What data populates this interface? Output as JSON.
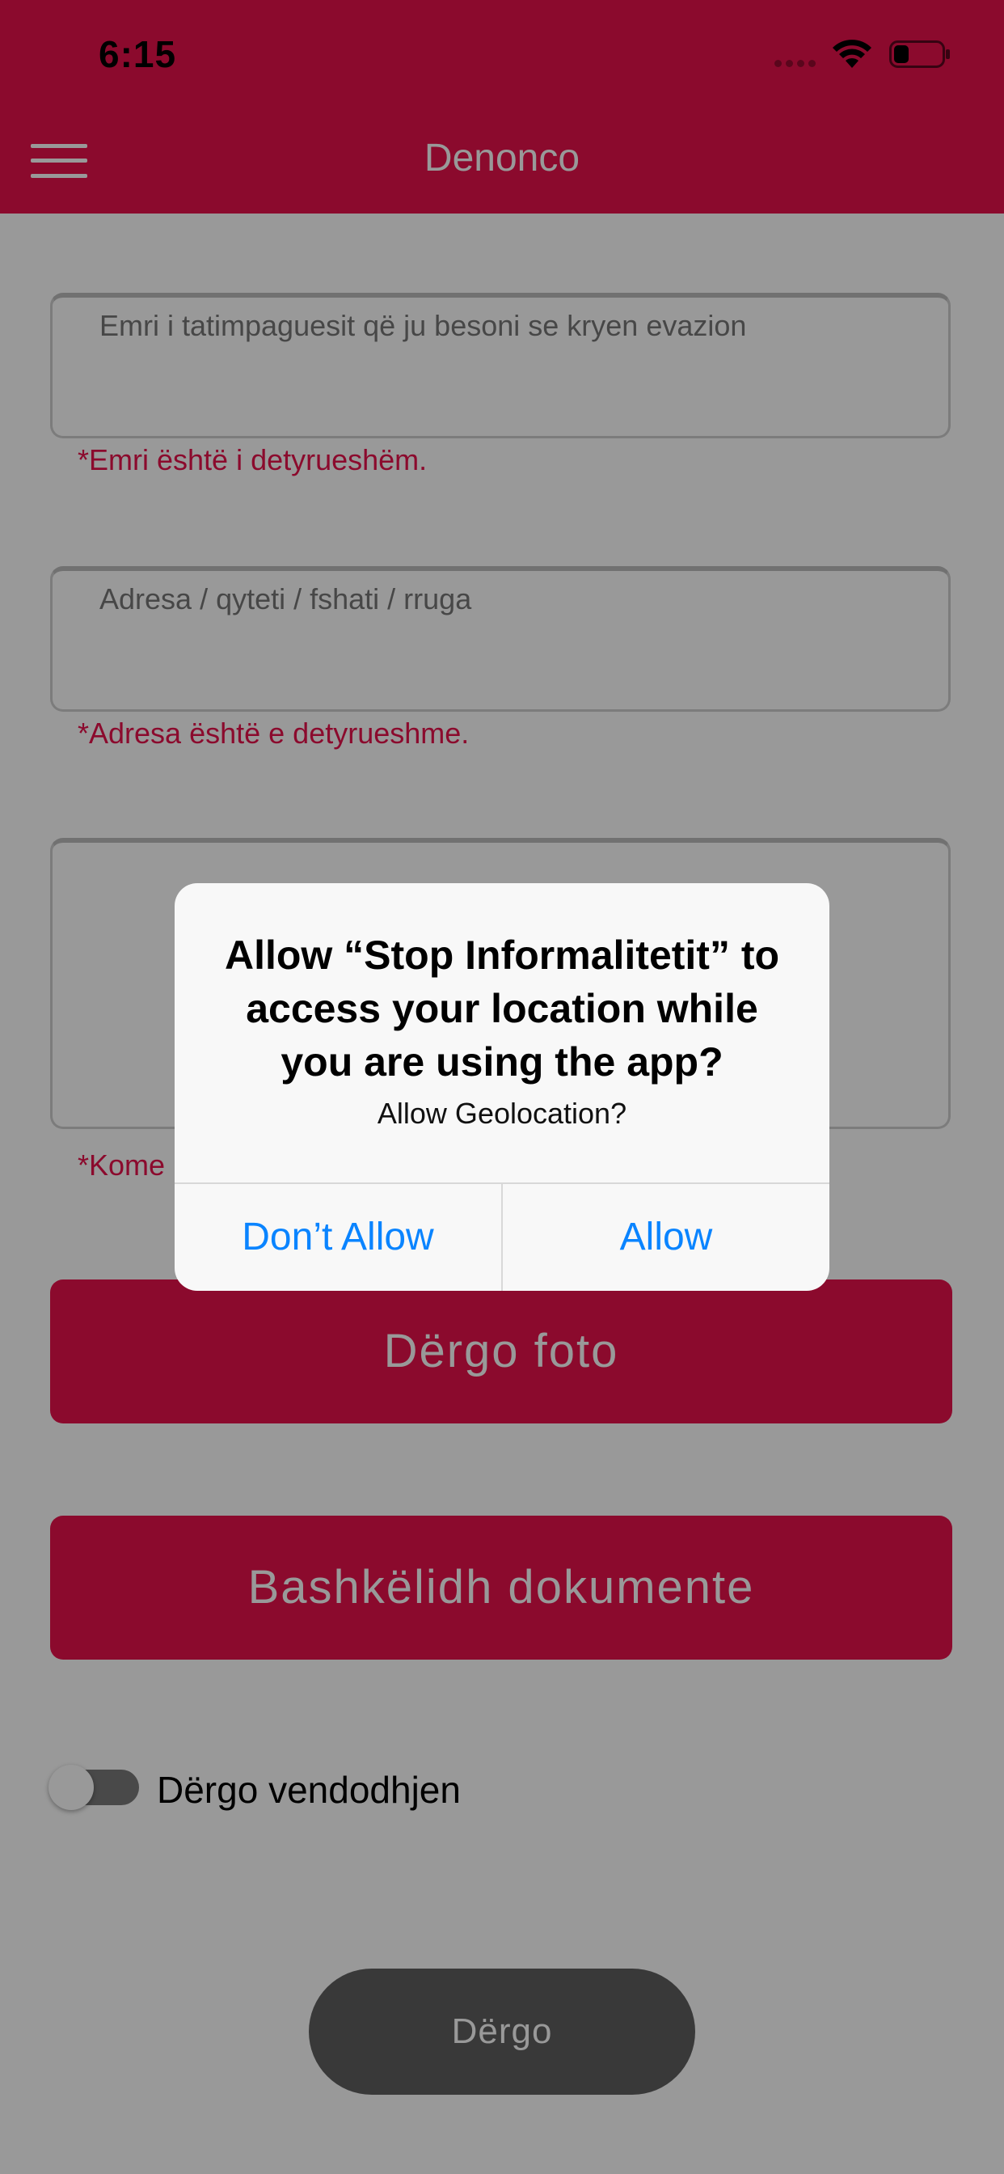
{
  "status_bar": {
    "time": "6:15"
  },
  "header": {
    "title": "Denonco",
    "menu_icon": "hamburger-menu-icon"
  },
  "form": {
    "name_field": {
      "placeholder": "Emri i tatimpaguesit që ju besoni se kryen evazion",
      "error": "*Emri është i detyrueshëm."
    },
    "address_field": {
      "placeholder": "Adresa / qyteti / fshati / rruga",
      "error": "*Adresa është e detyrueshme."
    },
    "comment_field": {
      "error": "*Kome"
    },
    "send_photo_label": "Dërgo foto",
    "attach_documents_label": "Bashkëlidh dokumente",
    "send_location_label": "Dërgo vendodhjen",
    "send_location_enabled": false,
    "submit_label": "Dërgo"
  },
  "alert": {
    "title": "Allow “Stop Informalitetit” to access your location while you are using the app?",
    "message": "Allow Geolocation?",
    "deny_label": "Don’t Allow",
    "allow_label": "Allow"
  },
  "colors": {
    "brand": "#e8114b",
    "link_blue": "#0a84ff"
  }
}
